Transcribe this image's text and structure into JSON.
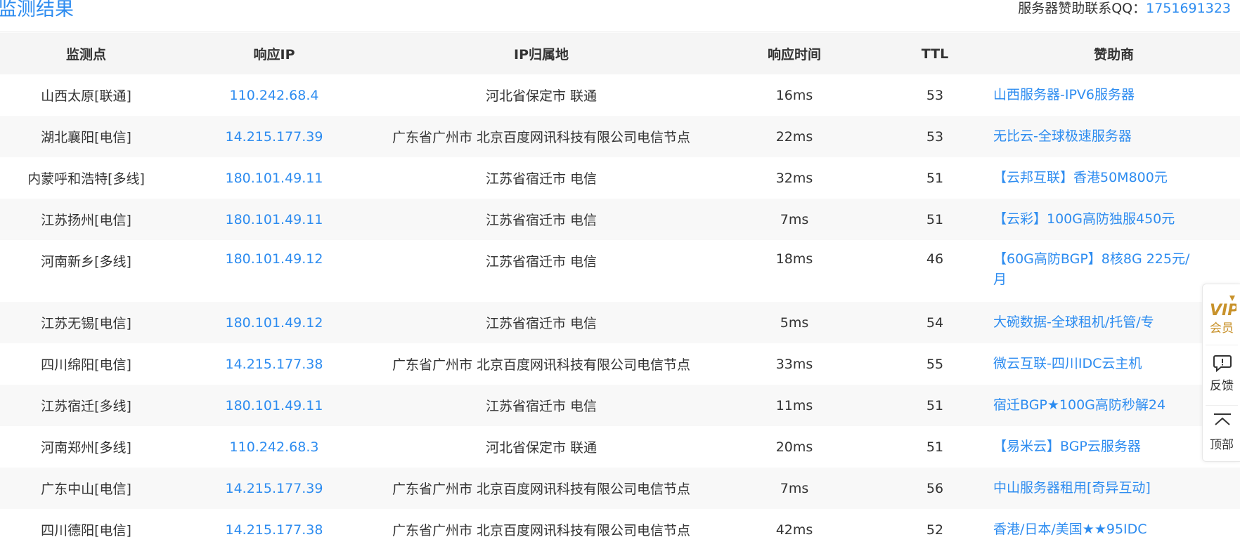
{
  "header": {
    "title": "监测结果",
    "sponsor_label": "服务器赞助联系QQ：",
    "sponsor_qq": "1751691323"
  },
  "table": {
    "columns": [
      "监测点",
      "响应IP",
      "IP归属地",
      "响应时间",
      "TTL",
      "赞助商"
    ],
    "rows": [
      {
        "point": "山西太原[联通]",
        "ip": "110.242.68.4",
        "location": "河北省保定市 联通",
        "time": "16ms",
        "ttl": "53",
        "sponsor": "山西服务器-IPV6服务器"
      },
      {
        "point": "湖北襄阳[电信]",
        "ip": "14.215.177.39",
        "location": "广东省广州市 北京百度网讯科技有限公司电信节点",
        "time": "22ms",
        "ttl": "53",
        "sponsor": "无比云-全球极速服务器"
      },
      {
        "point": "内蒙呼和浩特[多线]",
        "ip": "180.101.49.11",
        "location": "江苏省宿迁市 电信",
        "time": "32ms",
        "ttl": "51",
        "sponsor": "【云邦互联】香港50M800元"
      },
      {
        "point": "江苏扬州[电信]",
        "ip": "180.101.49.11",
        "location": "江苏省宿迁市 电信",
        "time": "7ms",
        "ttl": "51",
        "sponsor": "【云彩】100G高防独服450元"
      },
      {
        "point": "河南新乡[多线]",
        "ip": "180.101.49.12",
        "location": "江苏省宿迁市 电信",
        "time": "18ms",
        "ttl": "46",
        "sponsor_line1": "【60G高防BGP】8核8G 225元/",
        "sponsor_line2": "月"
      },
      {
        "point": "江苏无锡[电信]",
        "ip": "180.101.49.12",
        "location": "江苏省宿迁市 电信",
        "time": "5ms",
        "ttl": "54",
        "sponsor": "大碗数据-全球租机/托管/专"
      },
      {
        "point": "四川绵阳[电信]",
        "ip": "14.215.177.38",
        "location": "广东省广州市 北京百度网讯科技有限公司电信节点",
        "time": "33ms",
        "ttl": "55",
        "sponsor": "微云互联-四川IDC云主机"
      },
      {
        "point": "江苏宿迁[多线]",
        "ip": "180.101.49.11",
        "location": "江苏省宿迁市 电信",
        "time": "11ms",
        "ttl": "51",
        "sponsor": "宿迁BGP★100G高防秒解24"
      },
      {
        "point": "河南郑州[多线]",
        "ip": "110.242.68.3",
        "location": "河北省保定市 联通",
        "time": "20ms",
        "ttl": "51",
        "sponsor": "【易米云】BGP云服务器"
      },
      {
        "point": "广东中山[电信]",
        "ip": "14.215.177.39",
        "location": "广东省广州市 北京百度网讯科技有限公司电信节点",
        "time": "7ms",
        "ttl": "56",
        "sponsor": "中山服务器租用[奇异互动]"
      },
      {
        "point": "四川德阳[电信]",
        "ip": "14.215.177.38",
        "location": "广东省广州市 北京百度网讯科技有限公司电信节点",
        "time": "42ms",
        "ttl": "52",
        "sponsor": "香港/日本/美国★★95IDC"
      }
    ]
  },
  "side_float": {
    "vip_badge": "VIP",
    "vip_label": "会员",
    "feedback_label": "反馈",
    "top_label": "顶部"
  },
  "colors": {
    "accent": "#2d8cf0",
    "header_bg": "#f5f5f5",
    "row_alt": "#f8f8f8",
    "vip_gold": "#c8922b"
  }
}
